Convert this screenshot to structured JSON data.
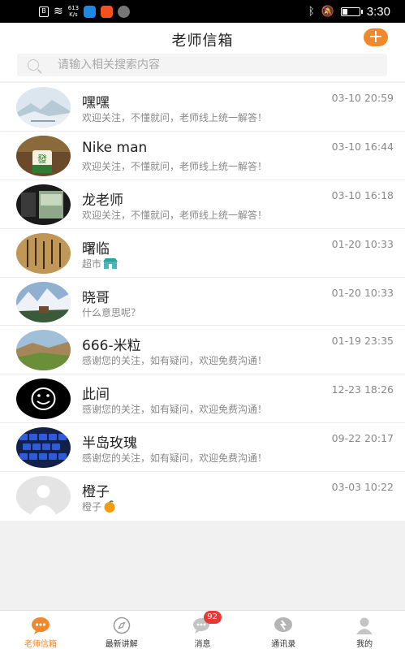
{
  "status_bar": {
    "net_speed_value": "613",
    "net_speed_unit": "K/s",
    "time": "3:30",
    "battery_level": 0.3
  },
  "header": {
    "title": "老师信箱",
    "add_button_label": "+",
    "search_placeholder": "请输入相关搜索内容"
  },
  "conversations": [
    {
      "name": "嘿嘿",
      "message": "欢迎关注，不懂就问，老师线上统一解答！",
      "time": "03-10 20:59",
      "avatar": "avatar-landscape"
    },
    {
      "name": "Nike man",
      "message": "欢迎关注，不懂就问，老师线上统一解答！",
      "time": "03-10 16:44",
      "avatar": "avatar-mahjong"
    },
    {
      "name": "龙老师",
      "message": "欢迎关注，不懂就问，老师线上统一解答！",
      "time": "03-10 16:18",
      "avatar": "avatar-painting"
    },
    {
      "name": "曙临",
      "message": "超市",
      "message_icon": "supermarket-icon",
      "time": "01-20 10:33",
      "avatar": "avatar-calligraphy"
    },
    {
      "name": "晓哥",
      "message": "什么意思呢？",
      "time": "01-20 10:33",
      "avatar": "avatar-mountain"
    },
    {
      "name": "666-米粒",
      "message": "感谢您的关注，如有疑问，欢迎免费沟通！",
      "time": "01-19 23:35",
      "avatar": "avatar-hills"
    },
    {
      "name": "此间",
      "message": "感谢您的关注，如有疑问，欢迎免费沟通！",
      "time": "12-23 18:26",
      "avatar": "avatar-smiley"
    },
    {
      "name": "半岛玫瑰",
      "message": "感谢您的关注，如有疑问，欢迎免费沟通！",
      "time": "09-22 20:17",
      "avatar": "avatar-keyboard"
    },
    {
      "name": "橙子",
      "message": "橙子",
      "message_icon": "orange-icon",
      "time": "03-03 10:22",
      "avatar": "avatar-default"
    }
  ],
  "tabs": [
    {
      "label": "老师信箱",
      "icon": "chat-bubble-icon",
      "active": true
    },
    {
      "label": "最新讲解",
      "icon": "compass-icon",
      "active": false
    },
    {
      "label": "消息",
      "icon": "message-icon",
      "active": false,
      "badge": "92"
    },
    {
      "label": "通讯录",
      "icon": "contacts-icon",
      "active": false
    },
    {
      "label": "我的",
      "icon": "profile-icon",
      "active": false
    }
  ],
  "colors": {
    "accent": "#f0892e",
    "badge": "#e53935",
    "text_primary": "#222222",
    "text_secondary": "#888888",
    "background": "#f1f1f1"
  }
}
